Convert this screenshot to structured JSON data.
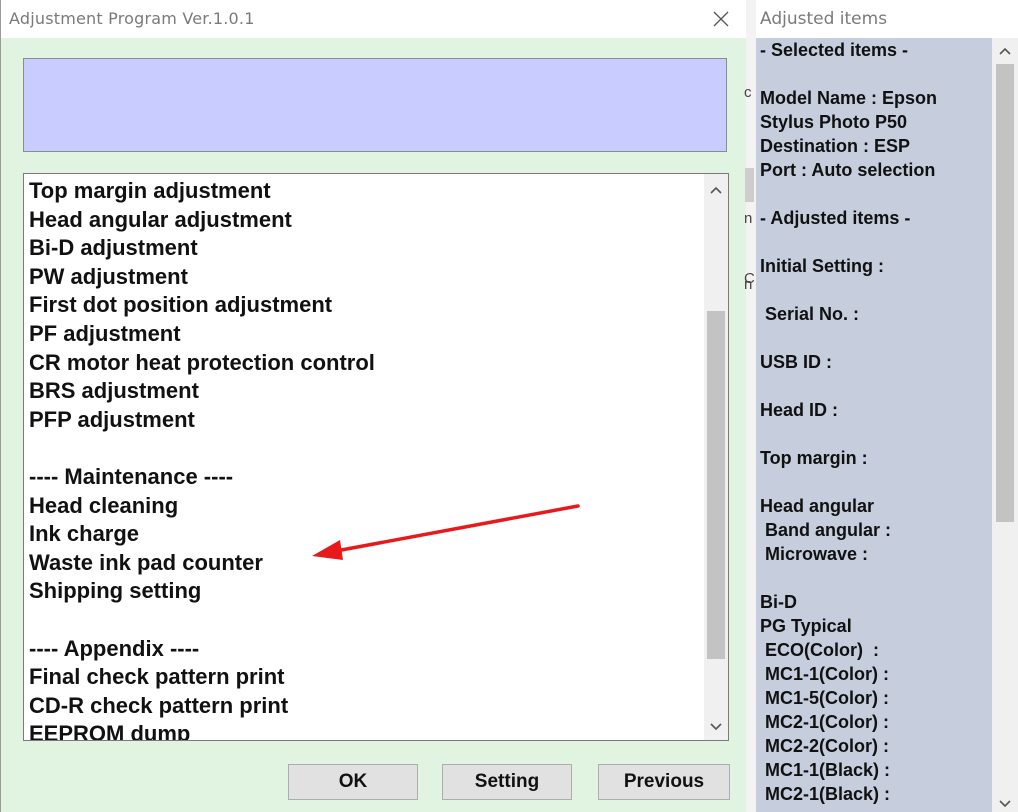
{
  "dialog": {
    "title": "Adjustment Program Ver.1.0.1",
    "list_items": [
      "Top margin adjustment",
      "Head angular adjustment",
      "Bi-D adjustment",
      "PW adjustment",
      "First dot position adjustment",
      "PF adjustment",
      "CR motor heat protection control",
      "BRS adjustment",
      "PFP adjustment",
      "",
      "---- Maintenance ----",
      "Head cleaning",
      "Ink charge",
      "Waste ink pad counter",
      "Shipping setting",
      "",
      "---- Appendix ----",
      "Final check pattern print",
      "CD-R check pattern print",
      "EEPROM dump"
    ],
    "buttons": {
      "ok": "OK",
      "setting": "Setting",
      "previous": "Previous"
    }
  },
  "background_fragments": [
    "c",
    "C",
    "n",
    "n"
  ],
  "right_panel": {
    "title": "Adjusted items",
    "lines": [
      "- Selected items -",
      "",
      "Model Name : Epson",
      "Stylus Photo P50",
      "Destination : ESP",
      "Port : Auto selection",
      "",
      "- Adjusted items -",
      "",
      "Initial Setting :",
      "",
      " Serial No. :",
      "",
      "USB ID :",
      "",
      "Head ID :",
      "",
      "Top margin :",
      "",
      "Head angular",
      " Band angular :",
      " Microwave :",
      "",
      "Bi-D",
      "PG Typical",
      " ECO(Color)  :",
      " MC1-1(Color) :",
      " MC1-5(Color) :",
      " MC2-1(Color) :",
      " MC2-2(Color) :",
      " MC1-1(Black) :",
      " MC2-1(Black) :"
    ]
  },
  "colors": {
    "dialog_bg": "#e1f4e1",
    "info_box_bg": "#c8ccff",
    "right_panel_bg": "#c6cede",
    "annotation_arrow": "#e8191b"
  },
  "icons": {
    "close": "close-icon",
    "scroll_up": "chevron-up-icon",
    "scroll_down": "chevron-down-icon",
    "annotation": "red-arrow-annotation"
  }
}
